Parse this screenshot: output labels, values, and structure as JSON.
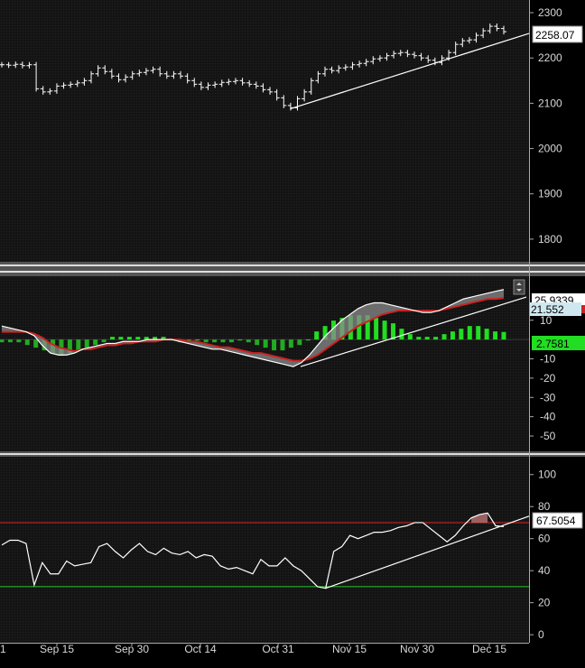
{
  "chart_data": [
    {
      "type": "ohlc",
      "title": "",
      "yticks": [
        1800,
        1900,
        2000,
        2100,
        2200,
        2300
      ],
      "ylim": [
        1750,
        2320
      ],
      "last_value_label": "2258.07",
      "last_value": 2258.07,
      "colors": {
        "bars": "#ffffff",
        "trendline": "#ffffff",
        "tag_bg": "#ffffff",
        "tag_text": "#000000"
      },
      "x": [
        0,
        1,
        2,
        3,
        4,
        5,
        6,
        7,
        8,
        9,
        10,
        11,
        12,
        13,
        14,
        15,
        16,
        17,
        18,
        19,
        20,
        21,
        22,
        23,
        24,
        25,
        26,
        27,
        28,
        29,
        30,
        31,
        32,
        33,
        34,
        35,
        36,
        37,
        38,
        39,
        40,
        41,
        42,
        43,
        44,
        45,
        46,
        47,
        48,
        49,
        50,
        51,
        52,
        53,
        54,
        55,
        56,
        57,
        58,
        59,
        60,
        61,
        62,
        63,
        64,
        65,
        66,
        67,
        68,
        69,
        70,
        71,
        72,
        73,
        74,
        75,
        76,
        77,
        78,
        79,
        80,
        81,
        82,
        83,
        84,
        85,
        86,
        87,
        88,
        89,
        90,
        91,
        92,
        93,
        94,
        95,
        96,
        97,
        98,
        99,
        100
      ],
      "close": [
        2185,
        2184,
        2186,
        2183,
        2185,
        2132,
        2125,
        2127,
        2138,
        2140,
        2142,
        2145,
        2150,
        2165,
        2178,
        2170,
        2160,
        2152,
        2158,
        2165,
        2168,
        2172,
        2175,
        2165,
        2160,
        2165,
        2160,
        2150,
        2142,
        2135,
        2140,
        2142,
        2146,
        2148,
        2150,
        2145,
        2142,
        2138,
        2130,
        2125,
        2112,
        2095,
        2090,
        2110,
        2125,
        2150,
        2165,
        2175,
        2172,
        2178,
        2180,
        2185,
        2188,
        2192,
        2198,
        2200,
        2205,
        2210,
        2212,
        2208,
        2205,
        2200,
        2195,
        2190,
        2200,
        2212,
        2230,
        2238,
        2240,
        2250,
        2260,
        2270,
        2265,
        2258
      ],
      "trendline": [
        {
          "x": 42,
          "y": 2088
        },
        {
          "x": 80,
          "y": 2270
        }
      ]
    },
    {
      "type": "macd",
      "yticks": [
        -50,
        -40,
        -30,
        -20,
        -10,
        10
      ],
      "ylim": [
        -57,
        30
      ],
      "labels": {
        "macd": "25.9339",
        "signal": "21.552",
        "histogram": "2.7581"
      },
      "colors": {
        "macd": "#ffffff",
        "signal": "#cc2222",
        "hist_pos": "#22dd22",
        "band": "#999999",
        "signal_tag_bg": "#cfe8f0",
        "hist_tag_bg": "#22dd22"
      },
      "macd": [
        7,
        6,
        5,
        4,
        2,
        -3,
        -7,
        -8,
        -8,
        -7,
        -5,
        -4,
        -3,
        -2,
        -2,
        -1,
        -1,
        -1,
        0,
        0,
        0,
        0,
        -1,
        -2,
        -3,
        -4,
        -5,
        -5,
        -6,
        -7,
        -8,
        -9,
        -10,
        -11,
        -12,
        -13,
        -14,
        -12,
        -8,
        -3,
        2,
        6,
        10,
        13,
        16,
        18,
        19,
        19,
        18,
        17,
        16,
        15,
        14,
        14,
        15,
        17,
        19,
        21,
        22,
        23,
        24,
        25,
        25.9
      ],
      "signal": [
        4,
        4,
        4,
        4,
        3,
        1,
        -2,
        -4,
        -5,
        -6,
        -5,
        -5,
        -4,
        -3,
        -3,
        -2,
        -2,
        -1,
        -1,
        -1,
        0,
        0,
        0,
        -1,
        -1,
        -2,
        -3,
        -4,
        -4,
        -5,
        -6,
        -7,
        -7,
        -8,
        -9,
        -10,
        -11,
        -11,
        -10,
        -8,
        -5,
        -2,
        1,
        4,
        7,
        9,
        11,
        13,
        14,
        15,
        15,
        15,
        15,
        15,
        15,
        16,
        17,
        18,
        19,
        20,
        21,
        21,
        21.6
      ],
      "histogram": [
        -1,
        -1,
        -1,
        -2,
        -3,
        -4,
        -5,
        -6,
        -5,
        -4,
        -3,
        -2,
        -1,
        1,
        1,
        1,
        1,
        1,
        1,
        1,
        0,
        -1,
        -1,
        0,
        -1,
        -1,
        -1,
        -1,
        0,
        -1,
        -2,
        -3,
        -4,
        -4,
        -3,
        -2,
        0,
        3,
        5,
        7,
        8,
        9,
        9,
        9,
        8,
        7,
        6,
        4,
        2,
        1,
        1,
        1,
        2,
        3,
        4,
        5,
        5,
        4,
        3,
        2.8
      ]
    },
    {
      "type": "rsi",
      "yticks": [
        0,
        20,
        40,
        60,
        80,
        100
      ],
      "ylim": [
        -5,
        110
      ],
      "labels": {
        "rsi": "67.5054"
      },
      "levels": [
        70,
        30
      ],
      "colors": {
        "line": "#ffffff",
        "upper": "#dd2222",
        "lower": "#22cc22",
        "overbought_fill": "#b07070"
      },
      "values": [
        56,
        59,
        59,
        57,
        31,
        45,
        38,
        38,
        46,
        43,
        44,
        45,
        55,
        57,
        52,
        48,
        53,
        57,
        52,
        50,
        54,
        51,
        50,
        52,
        48,
        50,
        49,
        43,
        41,
        42,
        40,
        38,
        47,
        43,
        43,
        48,
        43,
        40,
        35,
        30,
        29,
        52,
        55,
        62,
        60,
        62,
        64,
        64,
        65,
        67,
        68,
        70,
        70,
        66,
        62,
        58,
        62,
        68,
        73,
        75,
        76,
        68,
        67.5
      ],
      "trendline": [
        {
          "x": 42,
          "y": 29
        },
        {
          "x": 80,
          "y": 75
        }
      ]
    }
  ],
  "x_axis": {
    "labels": [
      "1",
      "Sep 15",
      "Sep 30",
      "Oct 14",
      "Oct 31",
      "Nov 15",
      "Nov 30",
      "Dec 15"
    ]
  }
}
